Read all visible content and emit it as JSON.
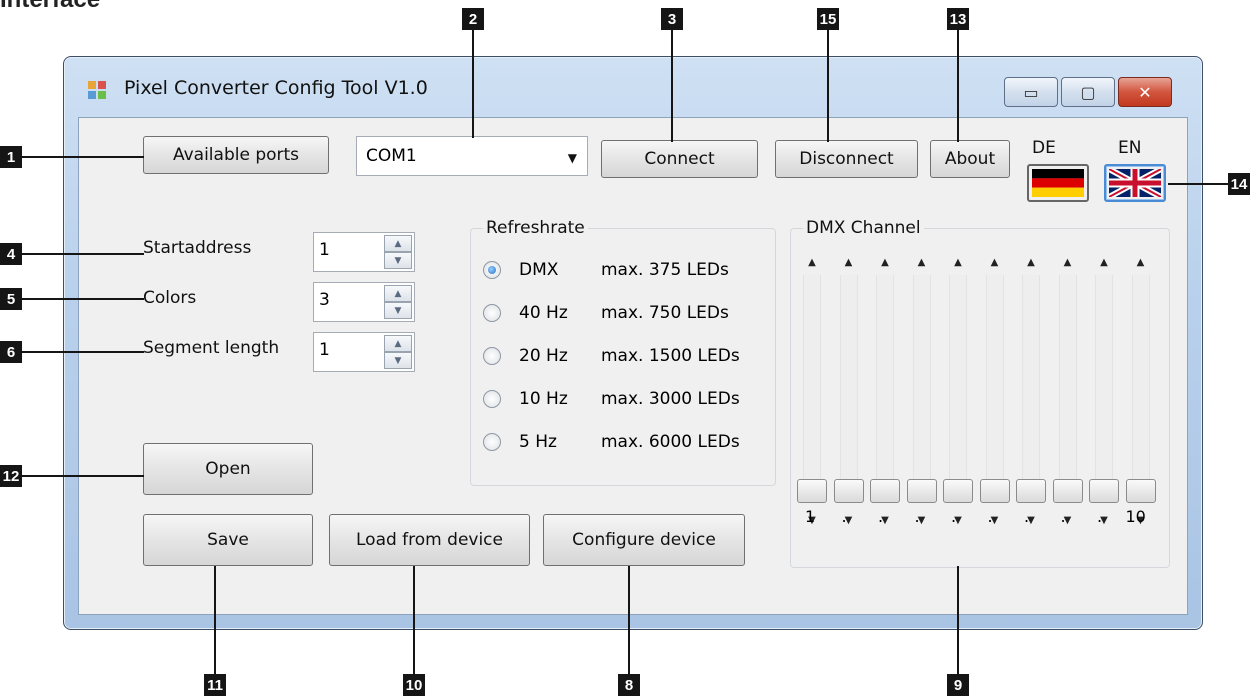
{
  "page_heading": "Interface",
  "window": {
    "title": "Pixel Converter Config Tool V1.0",
    "minimize_glyph": "▭",
    "maximize_glyph": "▢",
    "close_glyph": "✕"
  },
  "toolbar": {
    "available_ports_label": "Available ports",
    "port_selected": "COM1",
    "connect_label": "Connect",
    "disconnect_label": "Disconnect",
    "about_label": "About"
  },
  "language": {
    "de_label": "DE",
    "en_label": "EN",
    "active": "EN"
  },
  "settings": [
    {
      "label": "Startaddress",
      "value": "1"
    },
    {
      "label": "Colors",
      "value": "3"
    },
    {
      "label": "Segment length",
      "value": "1"
    }
  ],
  "refreshrate": {
    "title": "Refreshrate",
    "options": [
      {
        "freq": "DMX",
        "max": "max. 375 LEDs",
        "checked": true
      },
      {
        "freq": "40 Hz",
        "max": "max. 750 LEDs",
        "checked": false
      },
      {
        "freq": "20 Hz",
        "max": "max. 1500 LEDs",
        "checked": false
      },
      {
        "freq": "10 Hz",
        "max": "max. 3000 LEDs",
        "checked": false
      },
      {
        "freq": "5 Hz",
        "max": "max. 6000 LEDs",
        "checked": false
      }
    ]
  },
  "dmx": {
    "title": "DMX Channel",
    "channel_count": 10,
    "values": [
      0,
      0,
      0,
      0,
      0,
      0,
      0,
      0,
      0,
      0
    ],
    "scale_first": "1",
    "scale_last": "10",
    "scale_dot": "."
  },
  "actions": {
    "open_label": "Open",
    "save_label": "Save",
    "load_label": "Load from device",
    "configure_label": "Configure device"
  },
  "markers": [
    "1",
    "2",
    "3",
    "4",
    "5",
    "6",
    "8",
    "9",
    "10",
    "11",
    "12",
    "13",
    "14",
    "15"
  ],
  "colors": {
    "titlebar": "#b9d1ec",
    "close_button": "#d2553e",
    "radio_selected": "#1f6fc9"
  }
}
